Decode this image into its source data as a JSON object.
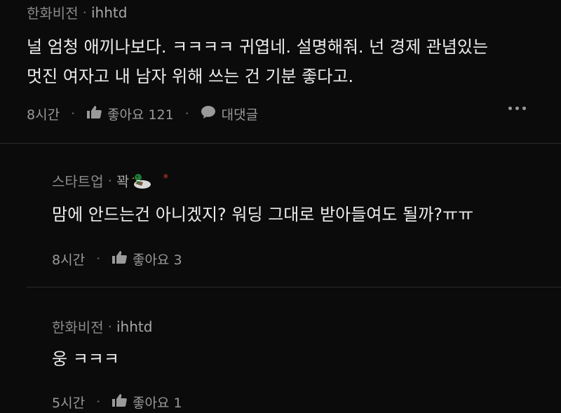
{
  "comments": [
    {
      "author": "한화비전",
      "handle": "ihhtd",
      "text_line1": "널 엄청 애끼나보다. ㅋㅋㅋㅋ 귀엽네. 설명해줘. 넌 경제 관념있는",
      "text_line2": "멋진 여자고 내 남자 위해 쓰는 건 기분 좋다고.",
      "time": "8시간",
      "like_label": "좋아요 121",
      "reply_label": "대댓글"
    },
    {
      "author": "스타트업",
      "handle": "꽉",
      "text": "맘에 안드는건 아니겠지? 워딩 그대로 받아들여도 될까?ㅠㅠ",
      "time": "8시간",
      "like_label": "좋아요 3",
      "star_symbol": "*"
    },
    {
      "author": "한화비전",
      "handle": "ihhtd",
      "text": "웅 ㅋㅋㅋ",
      "time": "5시간",
      "like_label": "좋아요 1"
    }
  ],
  "separator_dot": "·",
  "action_sep": "•",
  "colors": {
    "background": "#0b0b0b",
    "text": "#ececec",
    "meta": "#8a8a8a",
    "star": "#c0392b"
  },
  "icons": {
    "like": "thumbs-up-icon",
    "reply": "speech-bubble-icon",
    "more": "more-dots-icon",
    "badge": "duck-icon"
  }
}
